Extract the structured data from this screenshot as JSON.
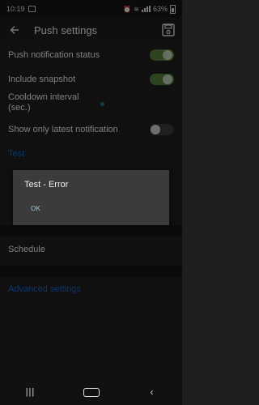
{
  "status_bar": {
    "time": "10:19",
    "battery": "63%",
    "icons": [
      "photo-icon",
      "alarm-icon",
      "wifi-icon",
      "signal-icon",
      "battery-icon"
    ]
  },
  "app_bar": {
    "title": "Push settings",
    "icons": [
      "back-arrow-icon",
      "save-icon"
    ]
  },
  "settings": {
    "push_notification_status": {
      "label": "Push notification status",
      "enabled": true
    },
    "include_snapshot": {
      "label": "Include snapshot",
      "enabled": true
    },
    "cooldown_interval": {
      "label": "Cooldown interval\n(sec.)"
    },
    "show_only_latest": {
      "label": "Show only latest notification",
      "enabled": false
    },
    "test_label": "Test",
    "schedule_label": "Schedule",
    "advanced_label": "Advanced settings"
  },
  "dialog": {
    "title": "Test - Error",
    "ok_label": "OK"
  },
  "colors": {
    "accent_link": "#1565c0",
    "toggle_on": "#4f7a3a",
    "dialog_bg": "#3b3b3b"
  }
}
